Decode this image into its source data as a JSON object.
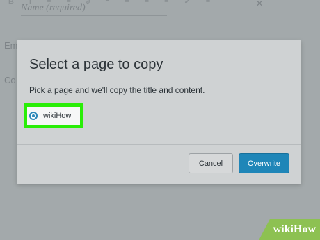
{
  "background": {
    "toolbar_glyphs": [
      "B",
      "I",
      "≡",
      "≡",
      "∂",
      "❝",
      "≡",
      "≡",
      "≡",
      "✓",
      "≡"
    ],
    "field_placeholder": "Name (required)",
    "field2_label": "Em",
    "field3_label": "Co"
  },
  "dialog": {
    "title": "Select a page to copy",
    "description": "Pick a page and we'll copy the title and content.",
    "selected_page": "wikiHow",
    "cancel_label": "Cancel",
    "overwrite_label": "Overwrite"
  },
  "watermark": {
    "text": "wikiHow"
  },
  "colors": {
    "highlight": "#29ee07",
    "primary_button": "#1f86b8",
    "radio": "#2c88b9",
    "watermark": "#8dc152"
  }
}
